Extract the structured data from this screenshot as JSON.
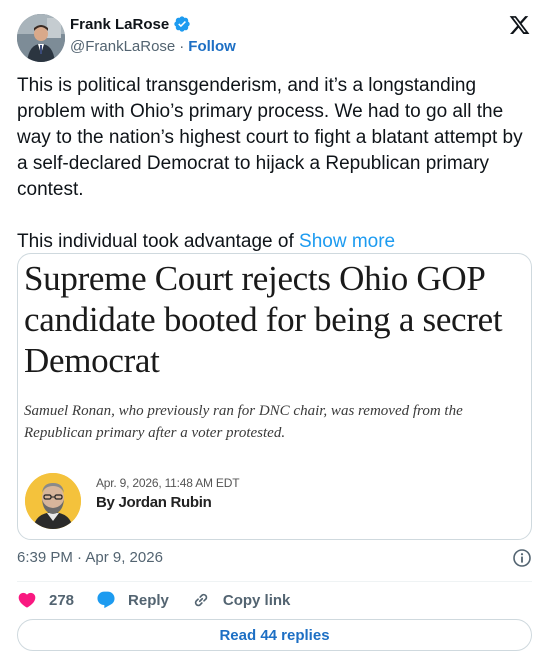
{
  "author": {
    "display_name": "Frank LaRose",
    "handle": "@FrankLaRose",
    "separator": "·",
    "follow_label": "Follow",
    "verified": true
  },
  "tweet": {
    "paragraph_1": "This is political transgenderism, and it’s a longstanding problem with Ohio’s primary process. We had to go all the way to the nation’s highest court to fight a blatant attempt by a self-declared Democrat to hijack a Republican primary contest.",
    "paragraph_2": "This individual took advantage of",
    "show_more_label": "Show more"
  },
  "article": {
    "headline": "Supreme Court rejects Ohio GOP candidate booted for being a secret Democrat",
    "dek": "Samuel Ronan, who previously ran for DNC chair, was removed from the Republican primary after a voter protested.",
    "date": "Apr. 9, 2026, 11:48 AM EDT",
    "byline": "By Jordan Rubin"
  },
  "meta": {
    "timestamp": "6:39 PM · Apr 9, 2026"
  },
  "actions": {
    "like_count": "278",
    "reply_label": "Reply",
    "copy_link_label": "Copy link"
  },
  "footer": {
    "read_replies_label": "Read 44 replies"
  },
  "colors": {
    "like": "#f91880",
    "reply": "#1d9bf0",
    "link": "#1d6fc4",
    "verified": "#1d9bf0",
    "author_photo_bg": "#f4c23c"
  }
}
